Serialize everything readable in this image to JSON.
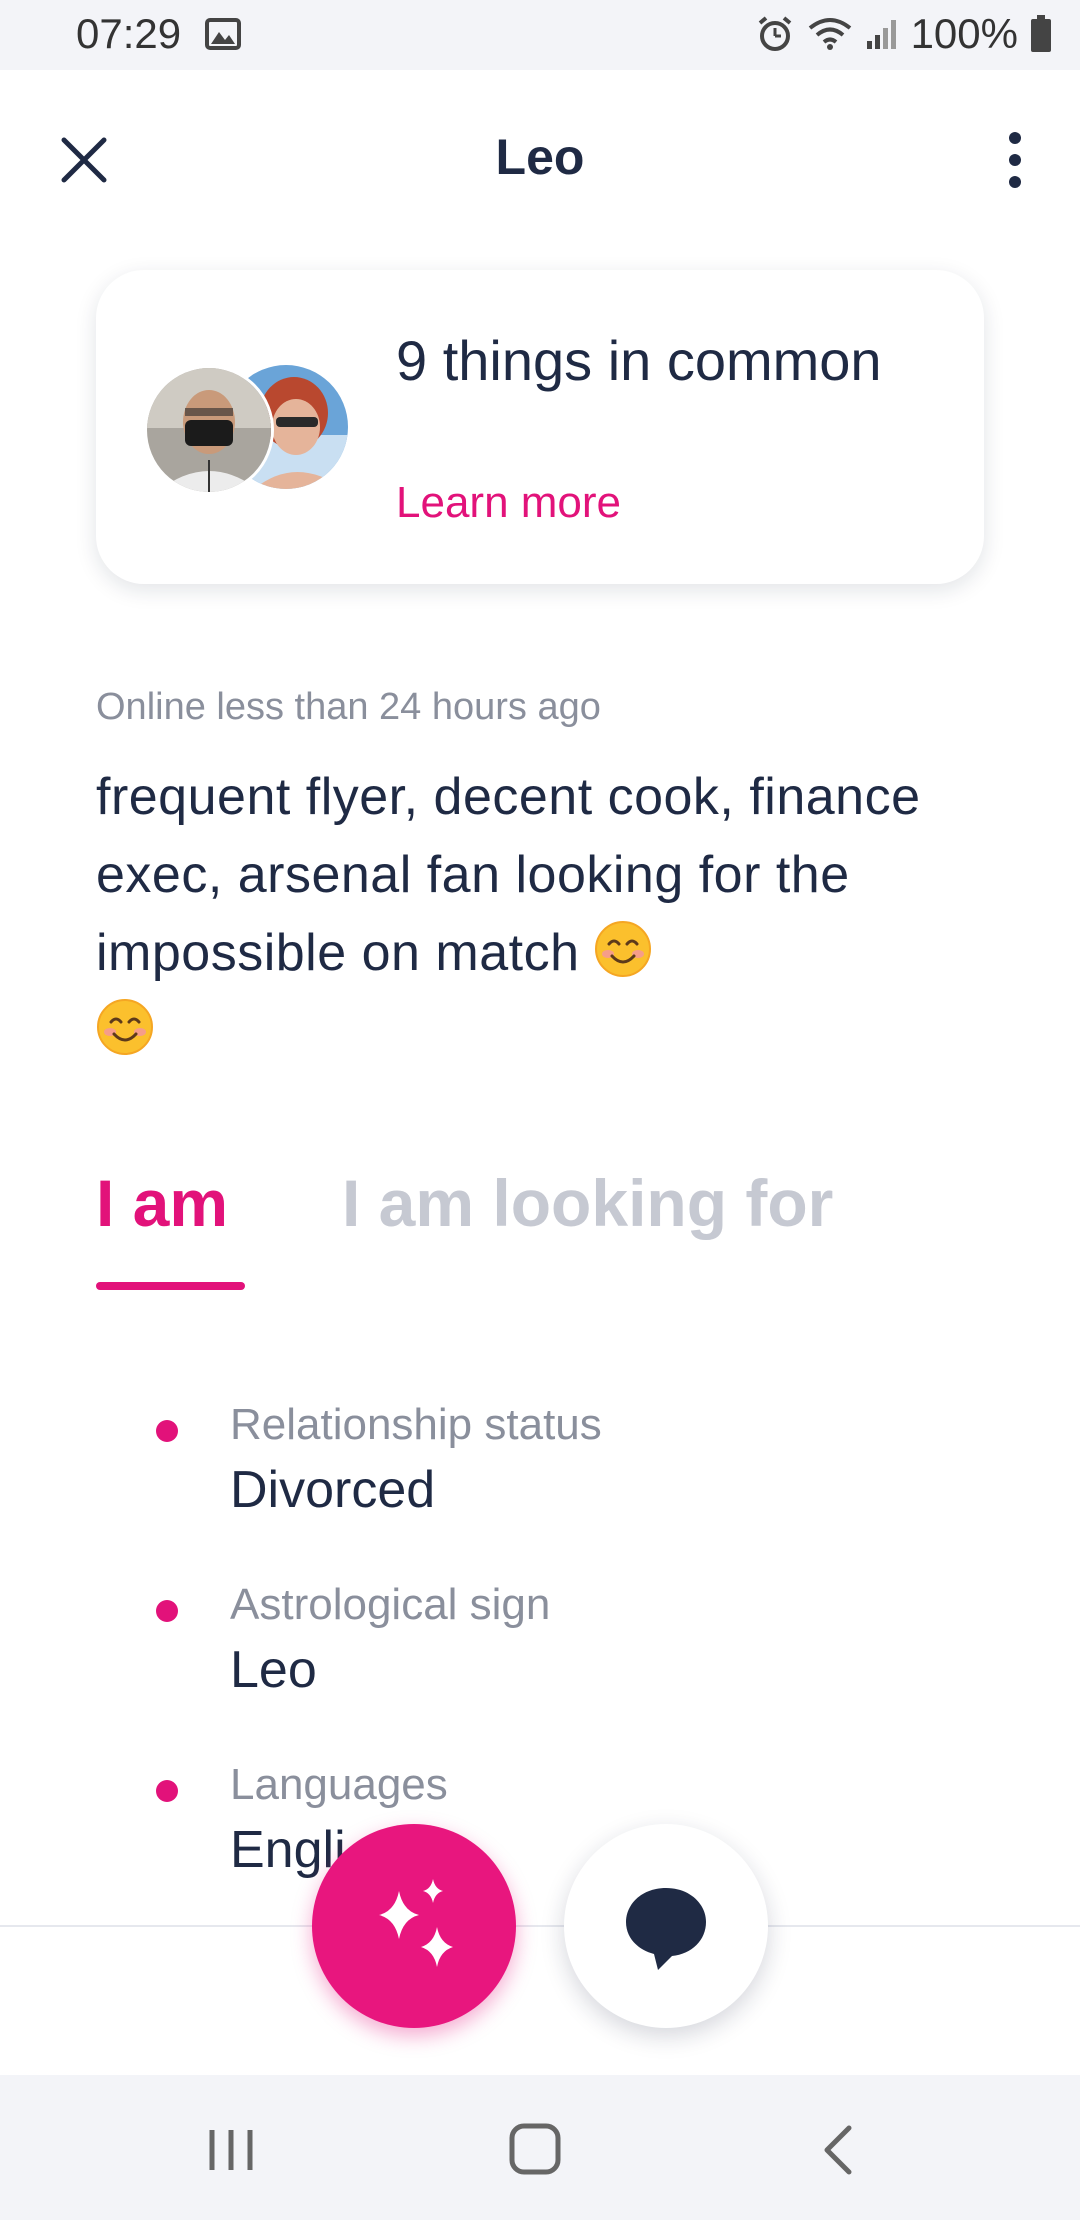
{
  "status_bar": {
    "time": "07:29",
    "battery": "100%"
  },
  "header": {
    "title": "Leo"
  },
  "common_card": {
    "title": "9 things in common",
    "link": "Learn more"
  },
  "profile": {
    "online_status": "Online less than 24 hours ago",
    "bio": "frequent flyer, decent cook, finance exec, arsenal fan looking for the impossible on match"
  },
  "tabs": [
    {
      "label": "I am",
      "active": true
    },
    {
      "label": "I am looking for",
      "active": false
    }
  ],
  "attributes": [
    {
      "label": "Relationship status",
      "value": "Divorced"
    },
    {
      "label": "Astrological sign",
      "value": "Leo"
    },
    {
      "label": "Languages",
      "value": "Engli"
    }
  ],
  "colors": {
    "accent": "#e2127a",
    "text": "#1f2a44",
    "muted": "#8a8f9c",
    "inactive_tab": "#c6c9d2"
  },
  "icons": {
    "close": "close-icon",
    "more": "more-vertical-icon",
    "sparkle": "sparkle-icon",
    "chat": "chat-bubble-icon"
  }
}
